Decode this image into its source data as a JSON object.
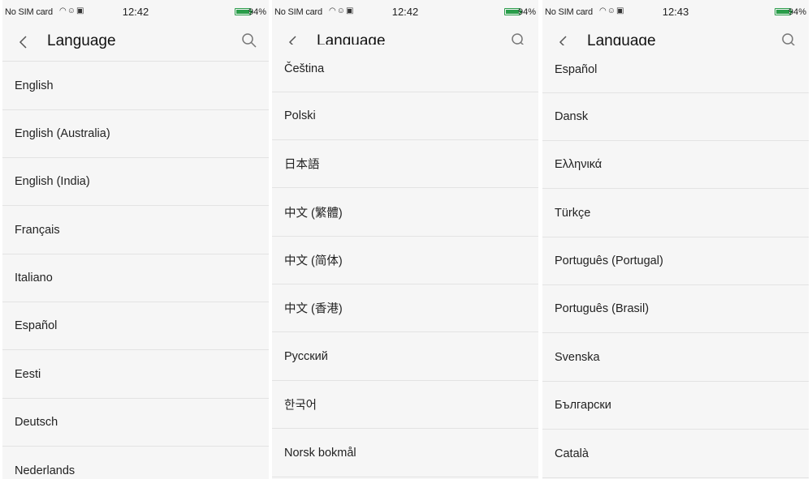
{
  "screens": [
    {
      "status": {
        "carrier": "No SIM card",
        "time": "12:42",
        "battery": "94%"
      },
      "title": "Language",
      "items": [
        "English",
        "English (Australia)",
        "English (India)",
        "Français",
        "Italiano",
        "Español",
        "Eesti",
        "Deutsch",
        "Nederlands"
      ]
    },
    {
      "status": {
        "carrier": "No SIM card",
        "time": "12:42",
        "battery": "94%"
      },
      "title": "Language",
      "items": [
        "Čeština",
        "Polski",
        "日本語",
        "中文 (繁體)",
        "中文 (简体)",
        "中文 (香港)",
        "Русский",
        "한국어",
        "Norsk bokmål"
      ]
    },
    {
      "status": {
        "carrier": "No SIM card",
        "time": "12:43",
        "battery": "94%"
      },
      "title": "Language",
      "items": [
        "Español",
        "Dansk",
        "Ελληνικά",
        "Türkçe",
        "Português (Portugal)",
        "Português (Brasil)",
        "Svenska",
        "Български",
        "Català"
      ]
    }
  ],
  "icons": {
    "back": "chevron-left-icon",
    "search": "search-icon",
    "wifi": "wifi-icon",
    "battery": "battery-icon"
  },
  "colors": {
    "background": "#f6f6f6",
    "divider": "#e3e3e3",
    "battery": "#2a9d4a"
  }
}
